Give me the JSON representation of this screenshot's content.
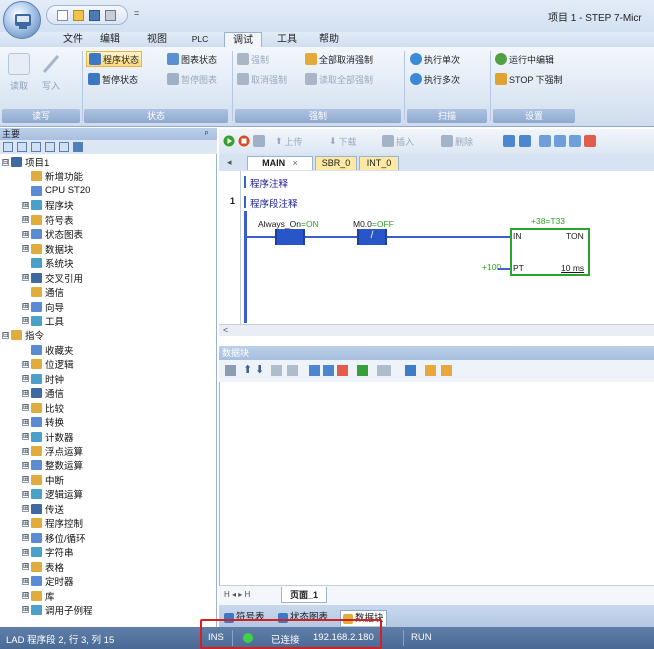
{
  "window": {
    "title": "项目 1 - STEP 7-Micr",
    "qat_more": "="
  },
  "menu": [
    "文件",
    "编辑",
    "视图",
    "PLC",
    "调试",
    "工具",
    "帮助"
  ],
  "menu_active": "调试",
  "ribbon": {
    "groups": [
      "读写",
      "状态",
      "强制",
      "扫描",
      "设置"
    ],
    "read": "读取",
    "write": "写入",
    "program_status": "程序状态",
    "pause_status": "暂停状态",
    "chart_status": "图表状态",
    "pause_chart": "暂停图表",
    "force": "强制",
    "unforce": "取消强制",
    "unforce_all": "全部取消强制",
    "read_all_forced": "读取全部强制",
    "single_scan": "执行单次",
    "multi_scan": "执行多次",
    "run_edit": "运行中编辑",
    "stop_force": "STOP 下强制"
  },
  "left_panel": {
    "header": "主要",
    "pin": "ᵖ",
    "tree": [
      {
        "label": "项目1",
        "exp": "⊟",
        "indent": 0
      },
      {
        "label": "新增功能",
        "exp": "",
        "indent": 1
      },
      {
        "label": "CPU ST20",
        "exp": "",
        "indent": 1
      },
      {
        "label": "程序块",
        "exp": "⊞",
        "indent": 1
      },
      {
        "label": "符号表",
        "exp": "⊞",
        "indent": 1
      },
      {
        "label": "状态图表",
        "exp": "⊞",
        "indent": 1
      },
      {
        "label": "数据块",
        "exp": "⊞",
        "indent": 1
      },
      {
        "label": "系统块",
        "exp": "",
        "indent": 1
      },
      {
        "label": "交叉引用",
        "exp": "⊞",
        "indent": 1
      },
      {
        "label": "通信",
        "exp": "",
        "indent": 1
      },
      {
        "label": "向导",
        "exp": "⊞",
        "indent": 1
      },
      {
        "label": "工具",
        "exp": "⊞",
        "indent": 1
      },
      {
        "label": "指令",
        "exp": "⊟",
        "indent": 0
      },
      {
        "label": "收藏夹",
        "exp": "",
        "indent": 1
      },
      {
        "label": "位逻辑",
        "exp": "⊞",
        "indent": 1
      },
      {
        "label": "时钟",
        "exp": "⊞",
        "indent": 1
      },
      {
        "label": "通信",
        "exp": "⊞",
        "indent": 1
      },
      {
        "label": "比较",
        "exp": "⊞",
        "indent": 1
      },
      {
        "label": "转换",
        "exp": "⊞",
        "indent": 1
      },
      {
        "label": "计数器",
        "exp": "⊞",
        "indent": 1
      },
      {
        "label": "浮点运算",
        "exp": "⊞",
        "indent": 1
      },
      {
        "label": "整数运算",
        "exp": "⊞",
        "indent": 1
      },
      {
        "label": "中断",
        "exp": "⊞",
        "indent": 1
      },
      {
        "label": "逻辑运算",
        "exp": "⊞",
        "indent": 1
      },
      {
        "label": "传送",
        "exp": "⊞",
        "indent": 1
      },
      {
        "label": "程序控制",
        "exp": "⊞",
        "indent": 1
      },
      {
        "label": "移位/循环",
        "exp": "⊞",
        "indent": 1
      },
      {
        "label": "字符串",
        "exp": "⊞",
        "indent": 1
      },
      {
        "label": "表格",
        "exp": "⊞",
        "indent": 1
      },
      {
        "label": "定时器",
        "exp": "⊞",
        "indent": 1
      },
      {
        "label": "库",
        "exp": "⊞",
        "indent": 1
      },
      {
        "label": "调用子例程",
        "exp": "⊞",
        "indent": 1
      }
    ]
  },
  "editor": {
    "toolbar": {
      "upload": "上传",
      "download": "下载",
      "insert": "插入",
      "delete": "删除"
    },
    "tabs": [
      "MAIN",
      "SBR_0",
      "INT_0"
    ],
    "tab_close": "×",
    "prev_arrow": "◂",
    "program_comment": "程序注释",
    "network_number": "1",
    "network_comment": "程序段注释",
    "contact1": {
      "label": "Always_On",
      "state": "=ON"
    },
    "contact2": {
      "label": "M0.0",
      "state": "=OFF",
      "symbol": "/"
    },
    "timer": {
      "current": "+38=T33",
      "in": "IN",
      "type": "TON",
      "preset": "+100",
      "pt": "PT",
      "base": "10 ms"
    },
    "scroll_left": "<"
  },
  "data_block": {
    "header": "数据块",
    "page_tab": "页面_1",
    "nav": "H ◂ ▸ H"
  },
  "bottom_tabs": [
    "符号表",
    "状态图表",
    "数据块"
  ],
  "status": {
    "position": "LAD 程序段 2, 行 3, 列 15",
    "mode": "INS",
    "connected": "已连接",
    "ip": "192.168.2.180",
    "run": "RUN"
  }
}
